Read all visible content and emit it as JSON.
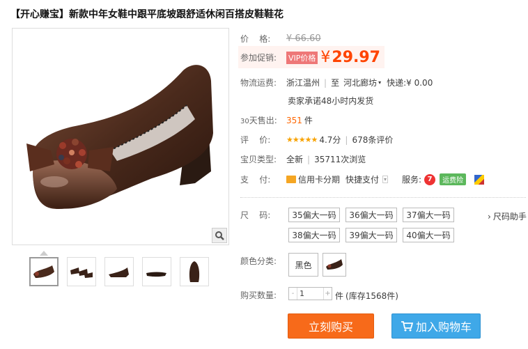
{
  "product": {
    "title": "【开心赚宝】新款中年女鞋中跟平底坡跟舒适休闲百搭皮鞋鞋花"
  },
  "price": {
    "label": "价    格:",
    "original": "¥ 66.60",
    "promo_label": "参加促销:",
    "vip_badge": "VIP价格",
    "currency": "¥",
    "current": "29.97"
  },
  "shipping": {
    "label": "物流运费:",
    "from": "浙江温州",
    "to_label": "至",
    "to": "河北廊坊",
    "express_label": "快递:",
    "express_fee": "¥ 0.00",
    "promise": "卖家承诺48小时内发货"
  },
  "sales": {
    "label_num": "30",
    "label_text": "天售出:",
    "count": "351",
    "unit": "件"
  },
  "rating": {
    "label": "评    价:",
    "stars": "★★★★★",
    "score": "4.7分",
    "reviews": "678条评价"
  },
  "product_type": {
    "label": "宝贝类型:",
    "condition": "全新",
    "views": "35711次浏览"
  },
  "payment": {
    "label": "支    付:",
    "credit": "信用卡分期",
    "quick": "快捷支付",
    "service_label": "服务:",
    "insurance": "运费险"
  },
  "size": {
    "label": "尺    码:",
    "options": [
      "35偏大一码",
      "36偏大一码",
      "37偏大一码",
      "38偏大一码",
      "39偏大一码",
      "40偏大一码"
    ],
    "helper": "尺码助手"
  },
  "color": {
    "label": "颜色分类:",
    "option_text": "黑色"
  },
  "quantity": {
    "label": "购买数量:",
    "value": "1",
    "minus": "-",
    "plus": "+",
    "unit": "件",
    "stock": "(库存1568件)"
  },
  "actions": {
    "buy_now": "立刻购买",
    "add_cart": "加入购物车"
  },
  "colors": {
    "price": "#ff4400",
    "buy_button": "#f76a1a",
    "cart_button": "#3fa8e8",
    "shoe": "#4a2a1c"
  }
}
